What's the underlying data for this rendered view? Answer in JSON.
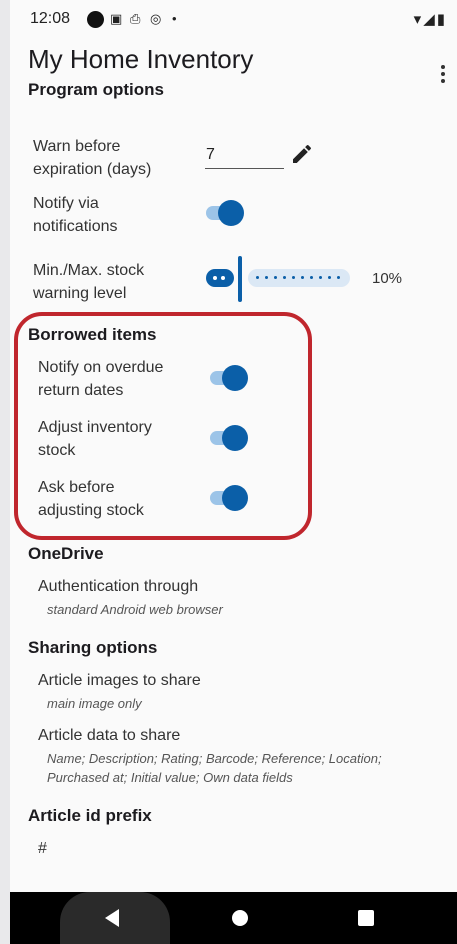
{
  "status_bar": {
    "time": "12:08"
  },
  "app": {
    "title": "My Home Inventory",
    "subtitle": "Program options"
  },
  "settings": {
    "warn_before_expiration": {
      "label_line1": "Warn before",
      "label_line2": "expiration (days)",
      "value": "7"
    },
    "notify_via_notifications": {
      "label_line1": "Notify via",
      "label_line2": "notifications",
      "enabled": true
    },
    "stock_warning_level": {
      "label_line1": "Min./Max. stock",
      "label_line2": "warning level",
      "value_text": "10%",
      "value": 0.1
    }
  },
  "borrowed_items": {
    "header": "Borrowed items",
    "notify_overdue": {
      "label_line1": "Notify on overdue",
      "label_line2": "return dates",
      "enabled": true
    },
    "adjust_stock": {
      "label_line1": "Adjust inventory",
      "label_line2": "stock",
      "enabled": true
    },
    "ask_before_adjusting": {
      "label_line1": "Ask before",
      "label_line2": "adjusting stock",
      "enabled": true
    }
  },
  "onedrive": {
    "header": "OneDrive",
    "auth_label": "Authentication through",
    "auth_value": "standard Android web browser"
  },
  "sharing": {
    "header": "Sharing options",
    "images_label": "Article images to share",
    "images_value": "main image only",
    "data_label": "Article data to share",
    "data_value_line1": "Name; Description; Rating; Barcode; Reference; Location;",
    "data_value_line2": "Purchased at; Initial value; Own data fields"
  },
  "article_id": {
    "header": "Article id prefix",
    "value": "#"
  },
  "colors": {
    "accent": "#0b5fa8",
    "highlight_border": "#c0262d"
  }
}
